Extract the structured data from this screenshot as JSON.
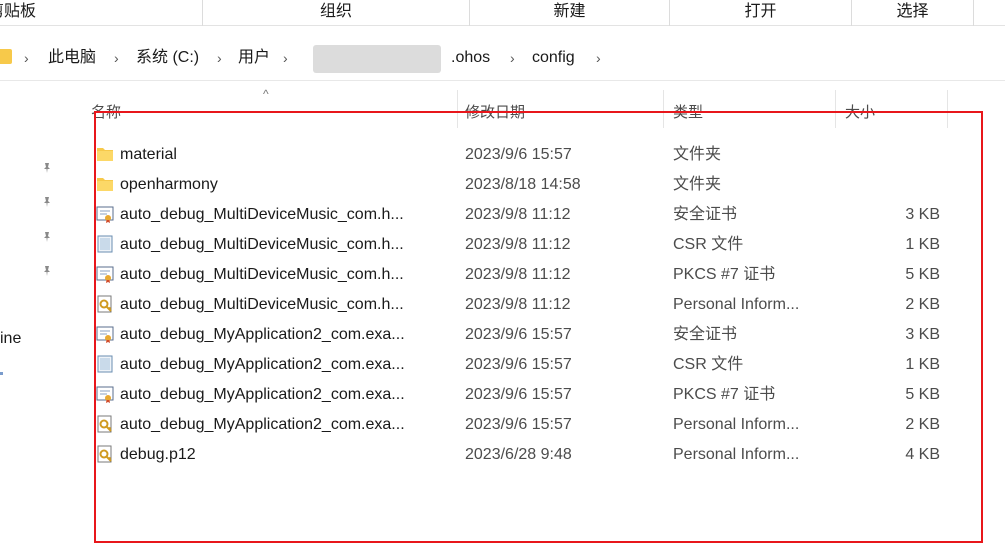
{
  "ribbon": {
    "groups": [
      "剪贴板",
      "组织",
      "新建",
      "打开",
      "选择"
    ]
  },
  "breadcrumb": {
    "items": [
      "此电脑",
      "系统 (C:)",
      "用户",
      ".ohos",
      "config"
    ]
  },
  "navpane": {
    "fragment": "ine"
  },
  "columns": {
    "name": "名称",
    "date": "修改日期",
    "type": "类型",
    "size": "大小"
  },
  "files": [
    {
      "icon": "folder-icon",
      "name": "material",
      "date": "2023/9/6 15:57",
      "type": "文件夹",
      "size": ""
    },
    {
      "icon": "folder-icon",
      "name": "openharmony",
      "date": "2023/8/18 14:58",
      "type": "文件夹",
      "size": ""
    },
    {
      "icon": "certificate-icon",
      "name": "auto_debug_MultiDeviceMusic_com.h...",
      "date": "2023/9/8 11:12",
      "type": "安全证书",
      "size": "3 KB"
    },
    {
      "icon": "csr-file-icon",
      "name": "auto_debug_MultiDeviceMusic_com.h...",
      "date": "2023/9/8 11:12",
      "type": "CSR 文件",
      "size": "1 KB"
    },
    {
      "icon": "certificate-icon",
      "name": "auto_debug_MultiDeviceMusic_com.h...",
      "date": "2023/9/8 11:12",
      "type": "PKCS #7 证书",
      "size": "5 KB"
    },
    {
      "icon": "personal-info-exchange-icon",
      "name": "auto_debug_MultiDeviceMusic_com.h...",
      "date": "2023/9/8 11:12",
      "type": "Personal Inform...",
      "size": "2 KB"
    },
    {
      "icon": "certificate-icon",
      "name": "auto_debug_MyApplication2_com.exa...",
      "date": "2023/9/6 15:57",
      "type": "安全证书",
      "size": "3 KB"
    },
    {
      "icon": "csr-file-icon",
      "name": "auto_debug_MyApplication2_com.exa...",
      "date": "2023/9/6 15:57",
      "type": "CSR 文件",
      "size": "1 KB"
    },
    {
      "icon": "certificate-icon",
      "name": "auto_debug_MyApplication2_com.exa...",
      "date": "2023/9/6 15:57",
      "type": "PKCS #7 证书",
      "size": "5 KB"
    },
    {
      "icon": "personal-info-exchange-icon",
      "name": "auto_debug_MyApplication2_com.exa...",
      "date": "2023/9/6 15:57",
      "type": "Personal Inform...",
      "size": "2 KB"
    },
    {
      "icon": "personal-info-exchange-icon",
      "name": "debug.p12",
      "date": "2023/6/28 9:48",
      "type": "Personal Inform...",
      "size": "4 KB"
    }
  ],
  "colors": {
    "annotation": "#e8161b",
    "folder": "#f7c94a"
  }
}
